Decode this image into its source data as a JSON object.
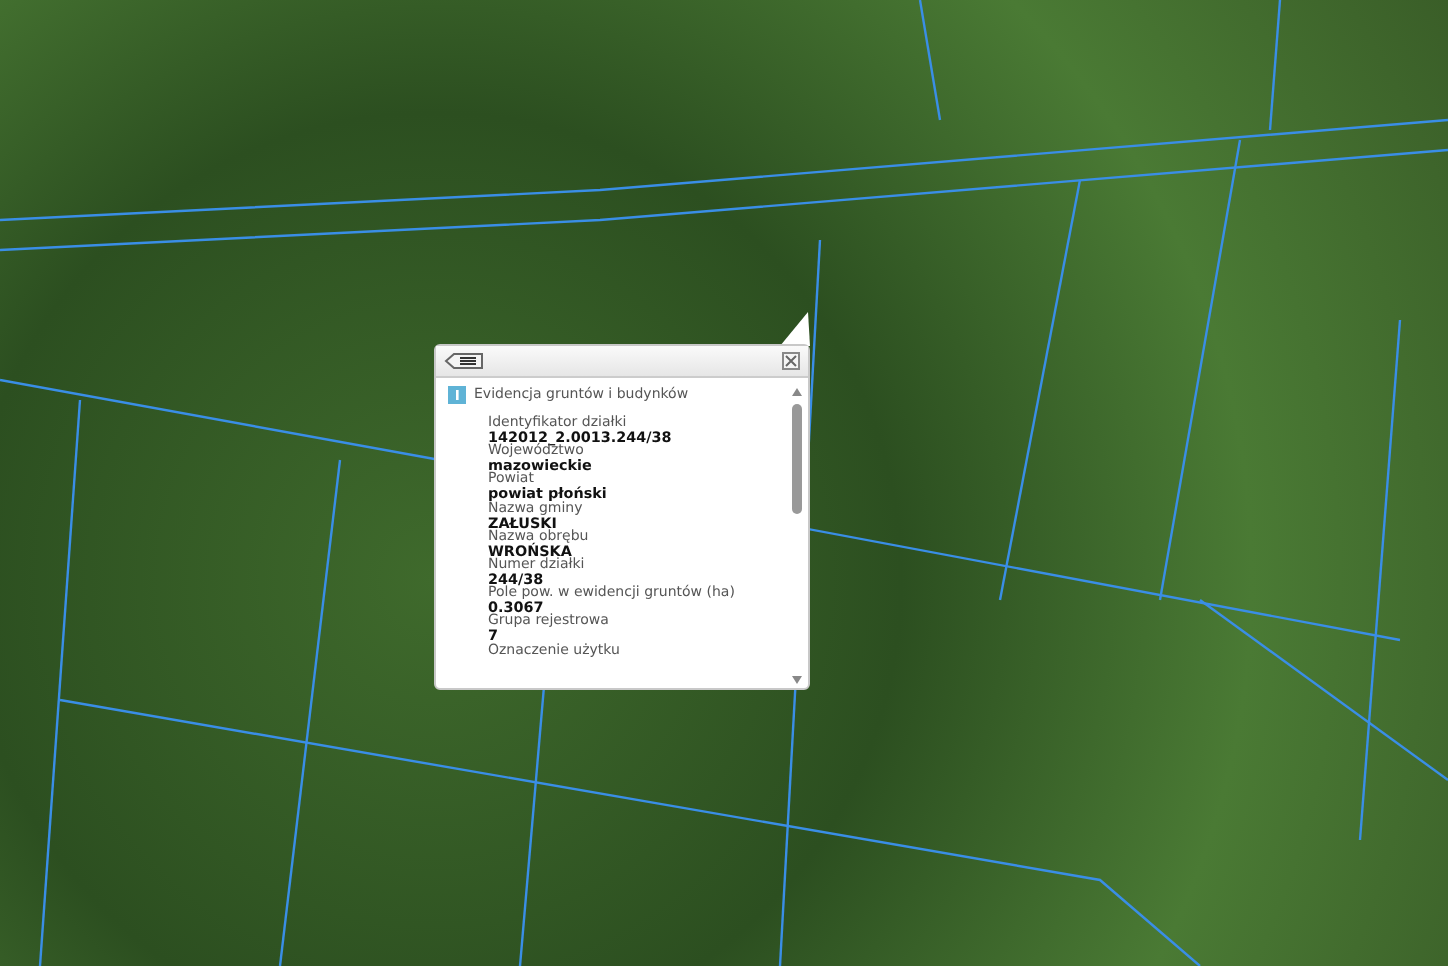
{
  "popup": {
    "title": "Evidencja gruntów i budynków",
    "fields": [
      {
        "label": "Identyfikator działki",
        "value": "142012_2.0013.244/38"
      },
      {
        "label": "Województwo",
        "value": "mazowieckie"
      },
      {
        "label": "Powiat",
        "value": "powiat płoński"
      },
      {
        "label": "Nazwa gminy",
        "value": "ZAŁUSKI"
      },
      {
        "label": "Nazwa obrębu",
        "value": "WROŃSKA"
      },
      {
        "label": "Numer działki",
        "value": "244/38"
      },
      {
        "label": "Pole pow. w ewidencji gruntów (ha)",
        "value": "0.3067"
      },
      {
        "label": "Grupa rejestrowa",
        "value": "7"
      },
      {
        "label": "Oznaczenie użytku"
      }
    ]
  }
}
